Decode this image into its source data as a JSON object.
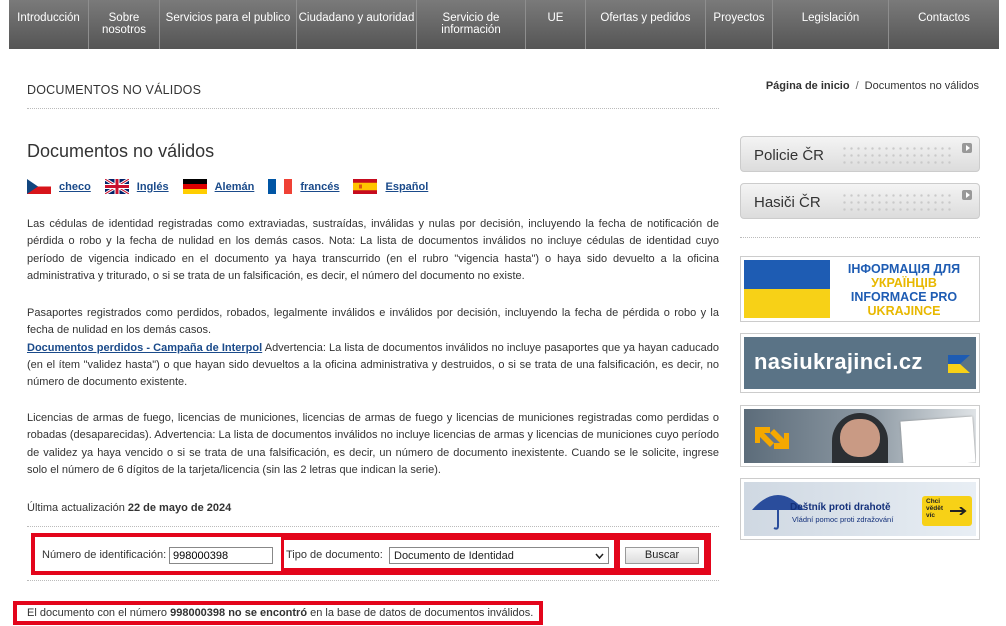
{
  "nav": {
    "items": [
      "Introducción",
      "Sobre\nnosotros",
      "Servicios para el publico",
      "Ciudadano y autoridad",
      "Servicio de\ninformación",
      "UE",
      "Ofertas y pedidos",
      "Proyectos",
      "Legislación",
      "Contactos"
    ]
  },
  "header": {
    "title": "DOCUMENTOS NO VÁLIDOS",
    "breadcrumb_home": "Página de inicio",
    "breadcrumb_sep": "/",
    "breadcrumb_current": "Documentos no válidos"
  },
  "main": {
    "heading": "Documentos no válidos",
    "languages": [
      {
        "label": "checo",
        "icon": "czech-flag-icon"
      },
      {
        "label": "Inglés",
        "icon": "uk-flag-icon"
      },
      {
        "label": "Alemán",
        "icon": "german-flag-icon"
      },
      {
        "label": "francés",
        "icon": "french-flag-icon"
      },
      {
        "label": "Español",
        "icon": "spanish-flag-icon"
      }
    ],
    "para1": "Las cédulas de identidad registradas como extraviadas, sustraídas, inválidas y nulas por decisión, incluyendo la fecha de notificación de pérdida o robo y la fecha de nulidad en los demás casos. Nota: La lista de documentos inválidos no incluye cédulas de identidad cuyo período de vigencia indicado en el documento ya haya transcurrido (en el rubro \"vigencia hasta\") o haya sido devuelto a la oficina administrativa y triturado, o si se trata de un falsificación, es decir, el número del documento no existe.",
    "para2_a": "Pasaportes registrados como perdidos, robados, legalmente inválidos e inválidos por decisión, incluyendo la fecha de pérdida o robo y la fecha de nulidad en los demás casos.",
    "para2_link": "Documentos perdidos - Campaña de Interpol",
    "para2_b": " Advertencia: La lista de documentos inválidos no incluye pasaportes que ya hayan caducado (en el ítem \"validez hasta\") o que hayan sido devueltos a la oficina administrativa y destruidos, o si se trata de una falsificación, es decir, no número de documento existente.",
    "para3": "Licencias de armas de fuego, licencias de municiones, licencias de armas de fuego y licencias de municiones registradas como perdidas o robadas (desaparecidas). Advertencia: La lista de documentos inválidos no incluye licencias de armas y licencias de municiones cuyo período de validez ya haya vencido o si se trata de una falsificación, es decir, un número de documento inexistente. Cuando se le solicite, ingrese solo el número de 6 dígitos de la tarjeta/licencia (sin las 2 letras que indican la serie).",
    "update_label": "Última actualización ",
    "update_date": "22 de mayo de 2024"
  },
  "form": {
    "id_label": "Número de identificación:",
    "id_value": "998000398",
    "type_label": "Tipo de documento:",
    "type_selected": "Documento de Identidad",
    "search_label": "Buscar"
  },
  "result": {
    "pre": "El documento con el número ",
    "strong": "998000398 no se encontró",
    "post": " en la base de datos de documentos inválidos."
  },
  "sidebar": {
    "buttons": [
      "Policie ČR",
      "Hasiči ČR"
    ],
    "banner_ua_line1": "ІНФОРМАЦІЯ ДЛЯ",
    "banner_ua_line2": "УКРАЇНЦІВ",
    "banner_ua_line3": "INFORMACE PRO",
    "banner_ua_line4": "UKRAJINCE",
    "banner_nasi": "nasiukrajinci.cz",
    "banner_destnik_title": "Deštník proti drahotě",
    "banner_destnik_sub": "Vládní pomoc proti zdražování",
    "banner_destnik_badge": "Chci\nvědět\nvíc"
  },
  "colors": {
    "accent_red": "#e3051b",
    "link": "#1a4a8a",
    "ua_blue": "#1e5cb3",
    "ua_yellow": "#f7d117"
  }
}
